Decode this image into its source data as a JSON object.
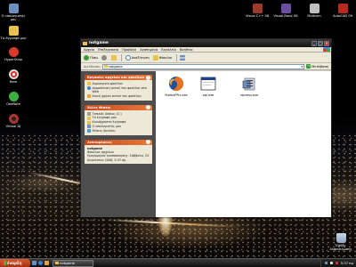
{
  "desktop_icons_left": [
    {
      "label": "Ο υπολογιστής",
      "label2": "μου",
      "icon": "computer-icon",
      "color": "#6d8fbf"
    },
    {
      "label": "Τα έγγραφά μου",
      "label2": "",
      "icon": "documents-folder-icon",
      "color": "#e8c24a"
    },
    {
      "label": "HyperSnap",
      "label2": "",
      "icon": "hypersnap-icon",
      "color": "#d83b2b"
    },
    {
      "label": "Nero",
      "label2": "",
      "icon": "nero-icon",
      "color": "#d9d9d9"
    },
    {
      "label": "OneNote",
      "label2": "",
      "icon": "onenote-icon",
      "color": "#3cb043"
    },
    {
      "label": "Virtual DJ",
      "label2": "",
      "icon": "virtual-dj-icon",
      "color": "#a33"
    }
  ],
  "desktop_icons_top": [
    {
      "label": "Visual C++ 08",
      "icon": "visual-cpp-icon",
      "color": "#9b3a2c"
    },
    {
      "label": "Visual Basic 08",
      "icon": "visual-basic-icon",
      "color": "#6b4fa0"
    },
    {
      "label": "Multisim",
      "icon": "multisim-icon",
      "color": "#c0c0c0"
    },
    {
      "label": "AutoCAD 09",
      "icon": "autocad-icon",
      "color": "#b72a1f"
    }
  ],
  "recycle_bin": {
    "label": "Κάδος",
    "label2": "Ανακύκλωσης",
    "icon": "recycle-bin-icon"
  },
  "window": {
    "title": "notgame",
    "menu": [
      "Αρχείο",
      "Επεξεργασία",
      "Προβολή",
      "Αγαπημένα",
      "Εργαλεία",
      "Βοήθεια"
    ],
    "toolbar": {
      "back": "Πίσω",
      "search": "Αναζήτηση",
      "folders": "Φάκελοι"
    },
    "address_label": "Διεύθυνση",
    "address_value": "notgame",
    "go_label": "Μετάβαση"
  },
  "tasks_panel": {
    "title": "Εργασίες αρχείων και φακέλων",
    "items": [
      "Δημιουργία φακέλου",
      "Δημοσίευση αυτού του φακέλου στο Web",
      "Κοινή χρήση αυτού του φακέλου"
    ]
  },
  "places_panel": {
    "title": "Άλλες θέσεις",
    "items": [
      "Τοπικός δίσκος (C:)",
      "Τα έγγραφά μου",
      "Κοινόχρηστα έγγραφα",
      "Ο υπολογιστής μου",
      "Θέσεις δικτύου"
    ]
  },
  "details_panel": {
    "title": "Λεπτομέρειες",
    "name": "notgame",
    "type": "Φάκελος αρχείων",
    "modified": "Ημερομηνία τροποποίησης: Σάββατο, 23 Αυγούστου 2008, 5:37 πμ"
  },
  "files": [
    {
      "name": "firefoxPFix.exe",
      "icon": "firefox-icon"
    },
    {
      "name": "api.exe",
      "icon": "application-window-icon"
    },
    {
      "name": "ntpress.exe",
      "icon": "installer-icon"
    }
  ],
  "taskbar": {
    "start_label": "έναρξη",
    "task_label": "notgame",
    "clock": "5:37 πμ"
  }
}
